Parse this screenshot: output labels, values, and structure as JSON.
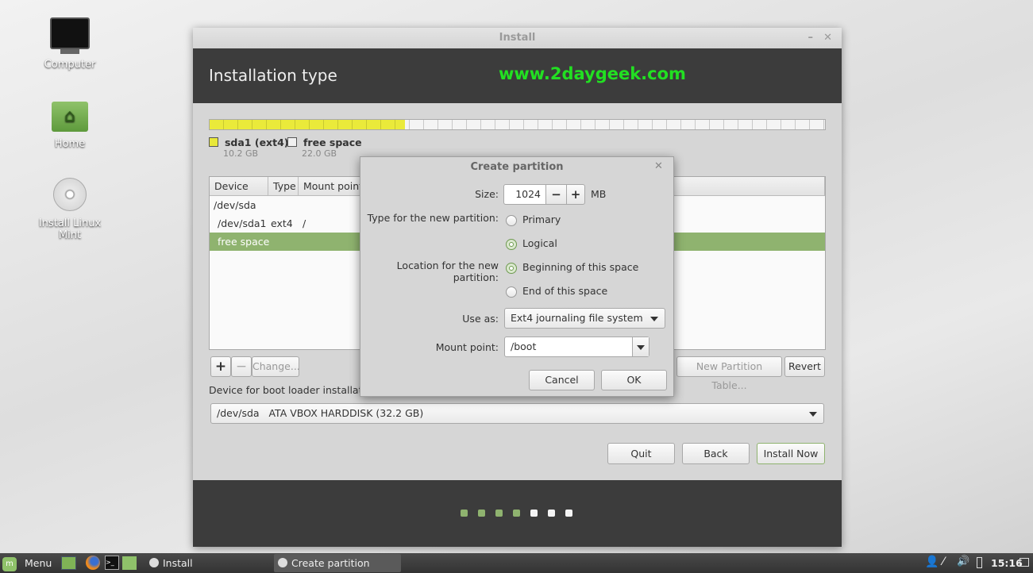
{
  "desktop": {
    "icons": [
      {
        "label": "Computer",
        "icon": "computer-icon"
      },
      {
        "label": "Home",
        "icon": "home-folder-icon"
      },
      {
        "label": "Install Linux Mint",
        "icon": "cd-icon"
      }
    ]
  },
  "window": {
    "title": "Install",
    "header_title": "Installation type",
    "watermark": "www.2daygeek.com",
    "legend": [
      {
        "name": "sda1 (ext4)",
        "size": "10.2 GB",
        "color": "#e8e83a"
      },
      {
        "name": "free space",
        "size": "22.0 GB",
        "color": "#f0f0f0"
      }
    ],
    "used_fraction": 0.317,
    "table": {
      "columns": [
        "Device",
        "Type",
        "Mount point"
      ],
      "rows": [
        {
          "device": "/dev/sda",
          "type": "",
          "mount": ""
        },
        {
          "device": "/dev/sda1",
          "type": "ext4",
          "mount": "/"
        },
        {
          "device": "free space",
          "type": "",
          "mount": "",
          "selected": true
        }
      ]
    },
    "buttons": {
      "add": "+",
      "remove": "−",
      "change": "Change...",
      "new_table": "New Partition Table...",
      "revert": "Revert",
      "quit": "Quit",
      "back": "Back",
      "install": "Install Now"
    },
    "boot_label": "Device for boot loader installation:",
    "boot_device": "/dev/sda   ATA VBOX HARDDISK (32.2 GB)",
    "progress": {
      "total_steps": 7,
      "completed_steps": 4
    }
  },
  "dialog": {
    "title": "Create partition",
    "size_label": "Size:",
    "size_value": "1024",
    "size_unit": "MB",
    "minus": "−",
    "plus": "+",
    "type_label": "Type for the new partition:",
    "type_options": [
      "Primary",
      "Logical"
    ],
    "type_selected": "Logical",
    "location_label": "Location for the new partition:",
    "location_options": [
      "Beginning of this space",
      "End of this space"
    ],
    "location_selected": "Beginning of this space",
    "use_as_label": "Use as:",
    "use_as_value": "Ext4 journaling file system",
    "mount_label": "Mount point:",
    "mount_value": "/boot",
    "cancel": "Cancel",
    "ok": "OK"
  },
  "taskbar": {
    "menu": "Menu",
    "tasks": [
      "Install",
      "Create partition"
    ],
    "clock": "15:16"
  },
  "colors": {
    "accent": "#8fb36f",
    "watermark": "#22e022",
    "dark": "#3c3c3c"
  }
}
